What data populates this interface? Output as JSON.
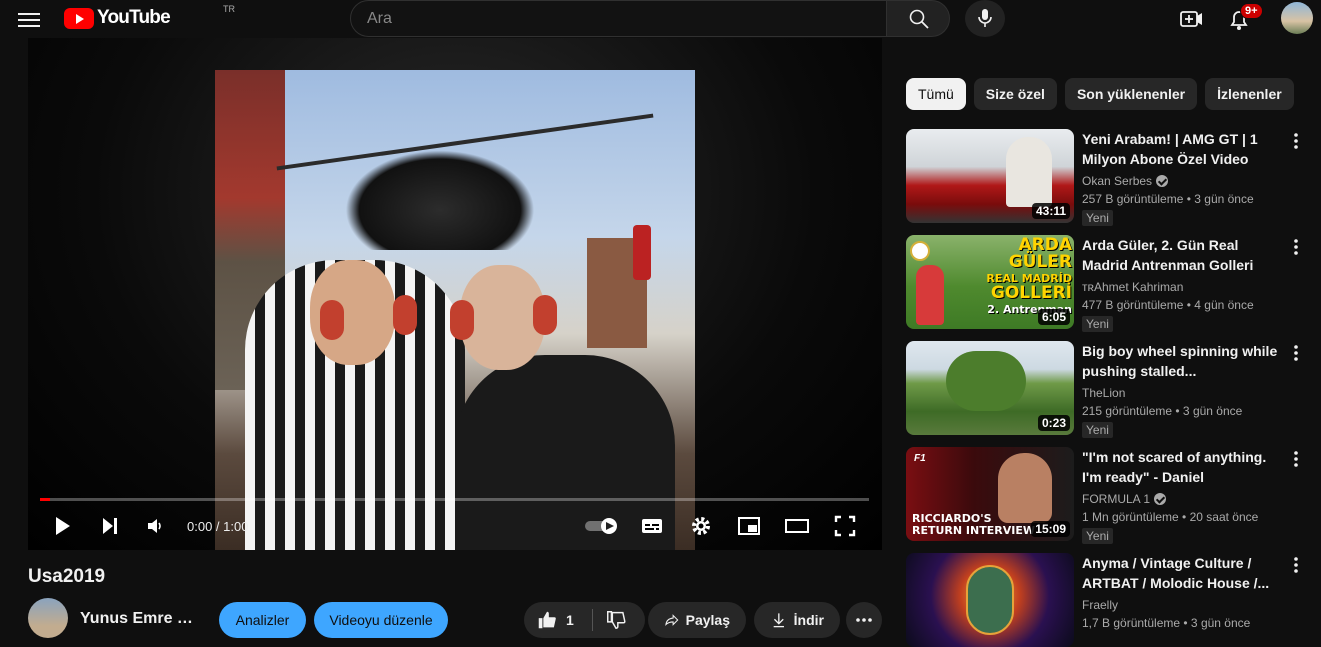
{
  "header": {
    "logo_text": "YouTube",
    "country_code": "TR",
    "search_placeholder": "Ara",
    "notification_count": "9+"
  },
  "player": {
    "time": "0:00 / 1:00",
    "progress_fraction": 0.012
  },
  "video": {
    "title": "Usa2019",
    "channel_name": "Yunus Emre H...",
    "buttons": {
      "analytics": "Analizler",
      "edit": "Videoyu düzenle",
      "like_count": "1",
      "share": "Paylaş",
      "download": "İndir"
    }
  },
  "chips": [
    "Tümü",
    "Size özel",
    "Son yüklenenler",
    "İzlenenler"
  ],
  "recommendations": [
    {
      "title": "Yeni Arabam! | AMG GT | 1 Milyon Abone Özel Video",
      "channel": "Okan Serbes",
      "verified": true,
      "meta": "257 B görüntüleme  • 3 gün önce",
      "badge": "Yeni",
      "duration": "43:11"
    },
    {
      "title": "Arda Güler, 2. Gün Real Madrid Antrenman Golleri ve...",
      "channel": "ᴛʀAhmet Kahriman",
      "verified": false,
      "meta": "477 B görüntüleme  • 4 gün önce",
      "badge": "Yeni",
      "duration": "6:05",
      "thumb_text": [
        "ARDA GÜLER",
        "REAL MADRİD",
        "GOLLERİ",
        "2. Antrenman"
      ]
    },
    {
      "title": "Big boy wheel spinning while pushing stalled...",
      "channel": "TheLion",
      "verified": false,
      "meta": "215 görüntüleme  • 3 gün önce",
      "badge": "Yeni",
      "duration": "0:23"
    },
    {
      "title": "\"I'm not scared of anything. I'm ready\" - Daniel Ricciardo...",
      "channel": "FORMULA 1",
      "verified": true,
      "meta": "1 Mn görüntüleme  • 20 saat önce",
      "badge": "Yeni",
      "duration": "15:09",
      "thumb_text": [
        "RICCIARDO'S",
        "RETURN INTERVIEW"
      ]
    },
    {
      "title": "Anyma / Vintage Culture / ARTBAT / Molodic House /...",
      "channel": "Fraelly",
      "verified": false,
      "meta": "1,7 B görüntüleme  • 3 gün önce",
      "badge": "",
      "duration": ""
    }
  ],
  "colors": {
    "background": "#0f0f0f",
    "brand_red": "#ff0000",
    "accent_blue": "#3ea6ff",
    "chip_bg": "#272727"
  }
}
